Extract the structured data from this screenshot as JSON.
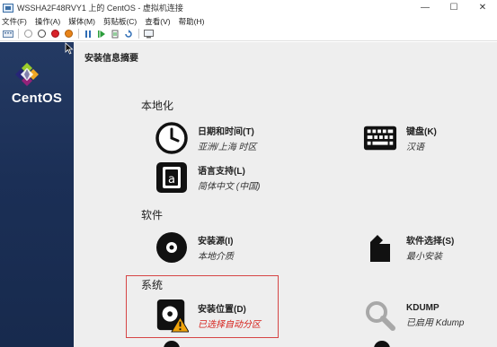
{
  "window": {
    "title": "WSSHA2F48RVY1 上的 CentOS - 虚拟机连接",
    "minimize": "—",
    "maximize": "☐",
    "close": "✕"
  },
  "menu": {
    "items": [
      "文件(F)",
      "操作(A)",
      "媒体(M)",
      "剪贴板(C)",
      "查看(V)",
      "帮助(H)"
    ]
  },
  "toolbar": {
    "icons": [
      "ctrl-alt-del-icon",
      "start-icon",
      "stop-icon",
      "shutdown-icon",
      "power-icon",
      "pause-icon",
      "resume-icon",
      "reset-icon",
      "checkpoint-icon",
      "revert-icon",
      "enhanced-session-icon"
    ]
  },
  "sidebar": {
    "brand": "CentOS",
    "colors": {
      "bg_top": "#243a63",
      "bg_bottom": "#172a4d"
    }
  },
  "hub": {
    "title": "安装信息摘要",
    "sections": {
      "localization": "本地化",
      "software": "软件",
      "system": "系统"
    },
    "spokes": {
      "datetime": {
        "title": "日期和时间(T)",
        "status": "亚洲/上海 时区",
        "icon": "clock-icon"
      },
      "keyboard": {
        "title": "键盘(K)",
        "status": "汉语",
        "icon": "keyboard-icon"
      },
      "language": {
        "title": "语言支持(L)",
        "status": "简体中文 (中国)",
        "icon": "language-icon"
      },
      "source": {
        "title": "安装源(I)",
        "status": "本地介质",
        "icon": "disc-icon"
      },
      "software": {
        "title": "软件选择(S)",
        "status": "最小安装",
        "icon": "package-icon"
      },
      "destination": {
        "title": "安装位置(D)",
        "status": "已选择自动分区",
        "icon": "harddisk-warning-icon"
      },
      "kdump": {
        "title": "KDUMP",
        "status": "已启用 Kdump",
        "icon": "search-icon"
      }
    },
    "colors": {
      "warning_text": "#d6211b",
      "highlight_border": "#d64545",
      "background": "#eeeeee"
    }
  }
}
